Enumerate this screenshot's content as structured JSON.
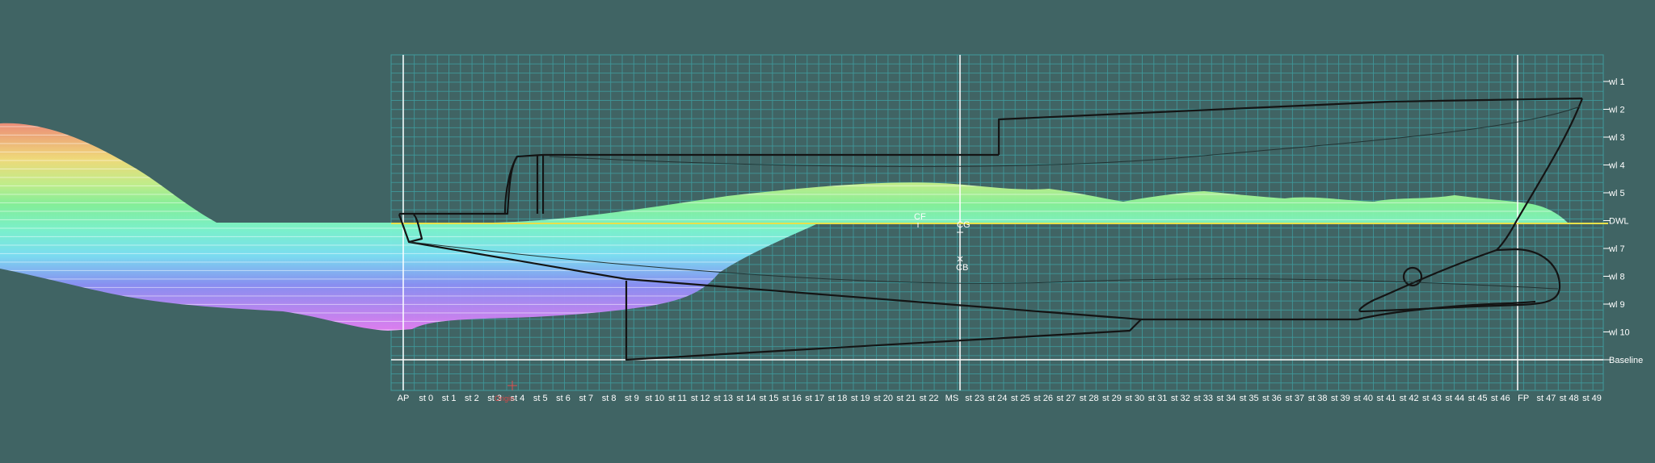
{
  "view": {
    "background": "#406464",
    "grid_color": "#3f9a9c",
    "hull_color": "#141414",
    "dwl_color": "#e8e04a"
  },
  "waterlines": [
    "wl 1",
    "wl 2",
    "wl 3",
    "wl 4",
    "wl 5",
    "DWL",
    "wl 7",
    "wl 8",
    "wl 9",
    "wl 10",
    "Baseline"
  ],
  "stations": [
    "AP",
    "st 0",
    "st 1",
    "st 2",
    "st 3",
    "st 4",
    "st 5",
    "st 6",
    "st 7",
    "st 8",
    "st 9",
    "st 10",
    "st 11",
    "st 12",
    "st 13",
    "st 14",
    "st 15",
    "st 16",
    "st 17",
    "st 18",
    "st 19",
    "st 20",
    "st 21",
    "st 22",
    "MS",
    "st 23",
    "st 24",
    "st 25",
    "st 26",
    "st 27",
    "st 28",
    "st 29",
    "st 30",
    "st 31",
    "st 32",
    "st 33",
    "st 34",
    "st 35",
    "st 36",
    "st 37",
    "st 38",
    "st 39",
    "st 40",
    "st 41",
    "st 42",
    "st 43",
    "st 44",
    "st 45",
    "st 46",
    "FP",
    "st 47",
    "st 48",
    "st 49"
  ],
  "markers": {
    "cf": "CF",
    "cg": "CG",
    "cb": "CB",
    "origin": "Origin"
  }
}
